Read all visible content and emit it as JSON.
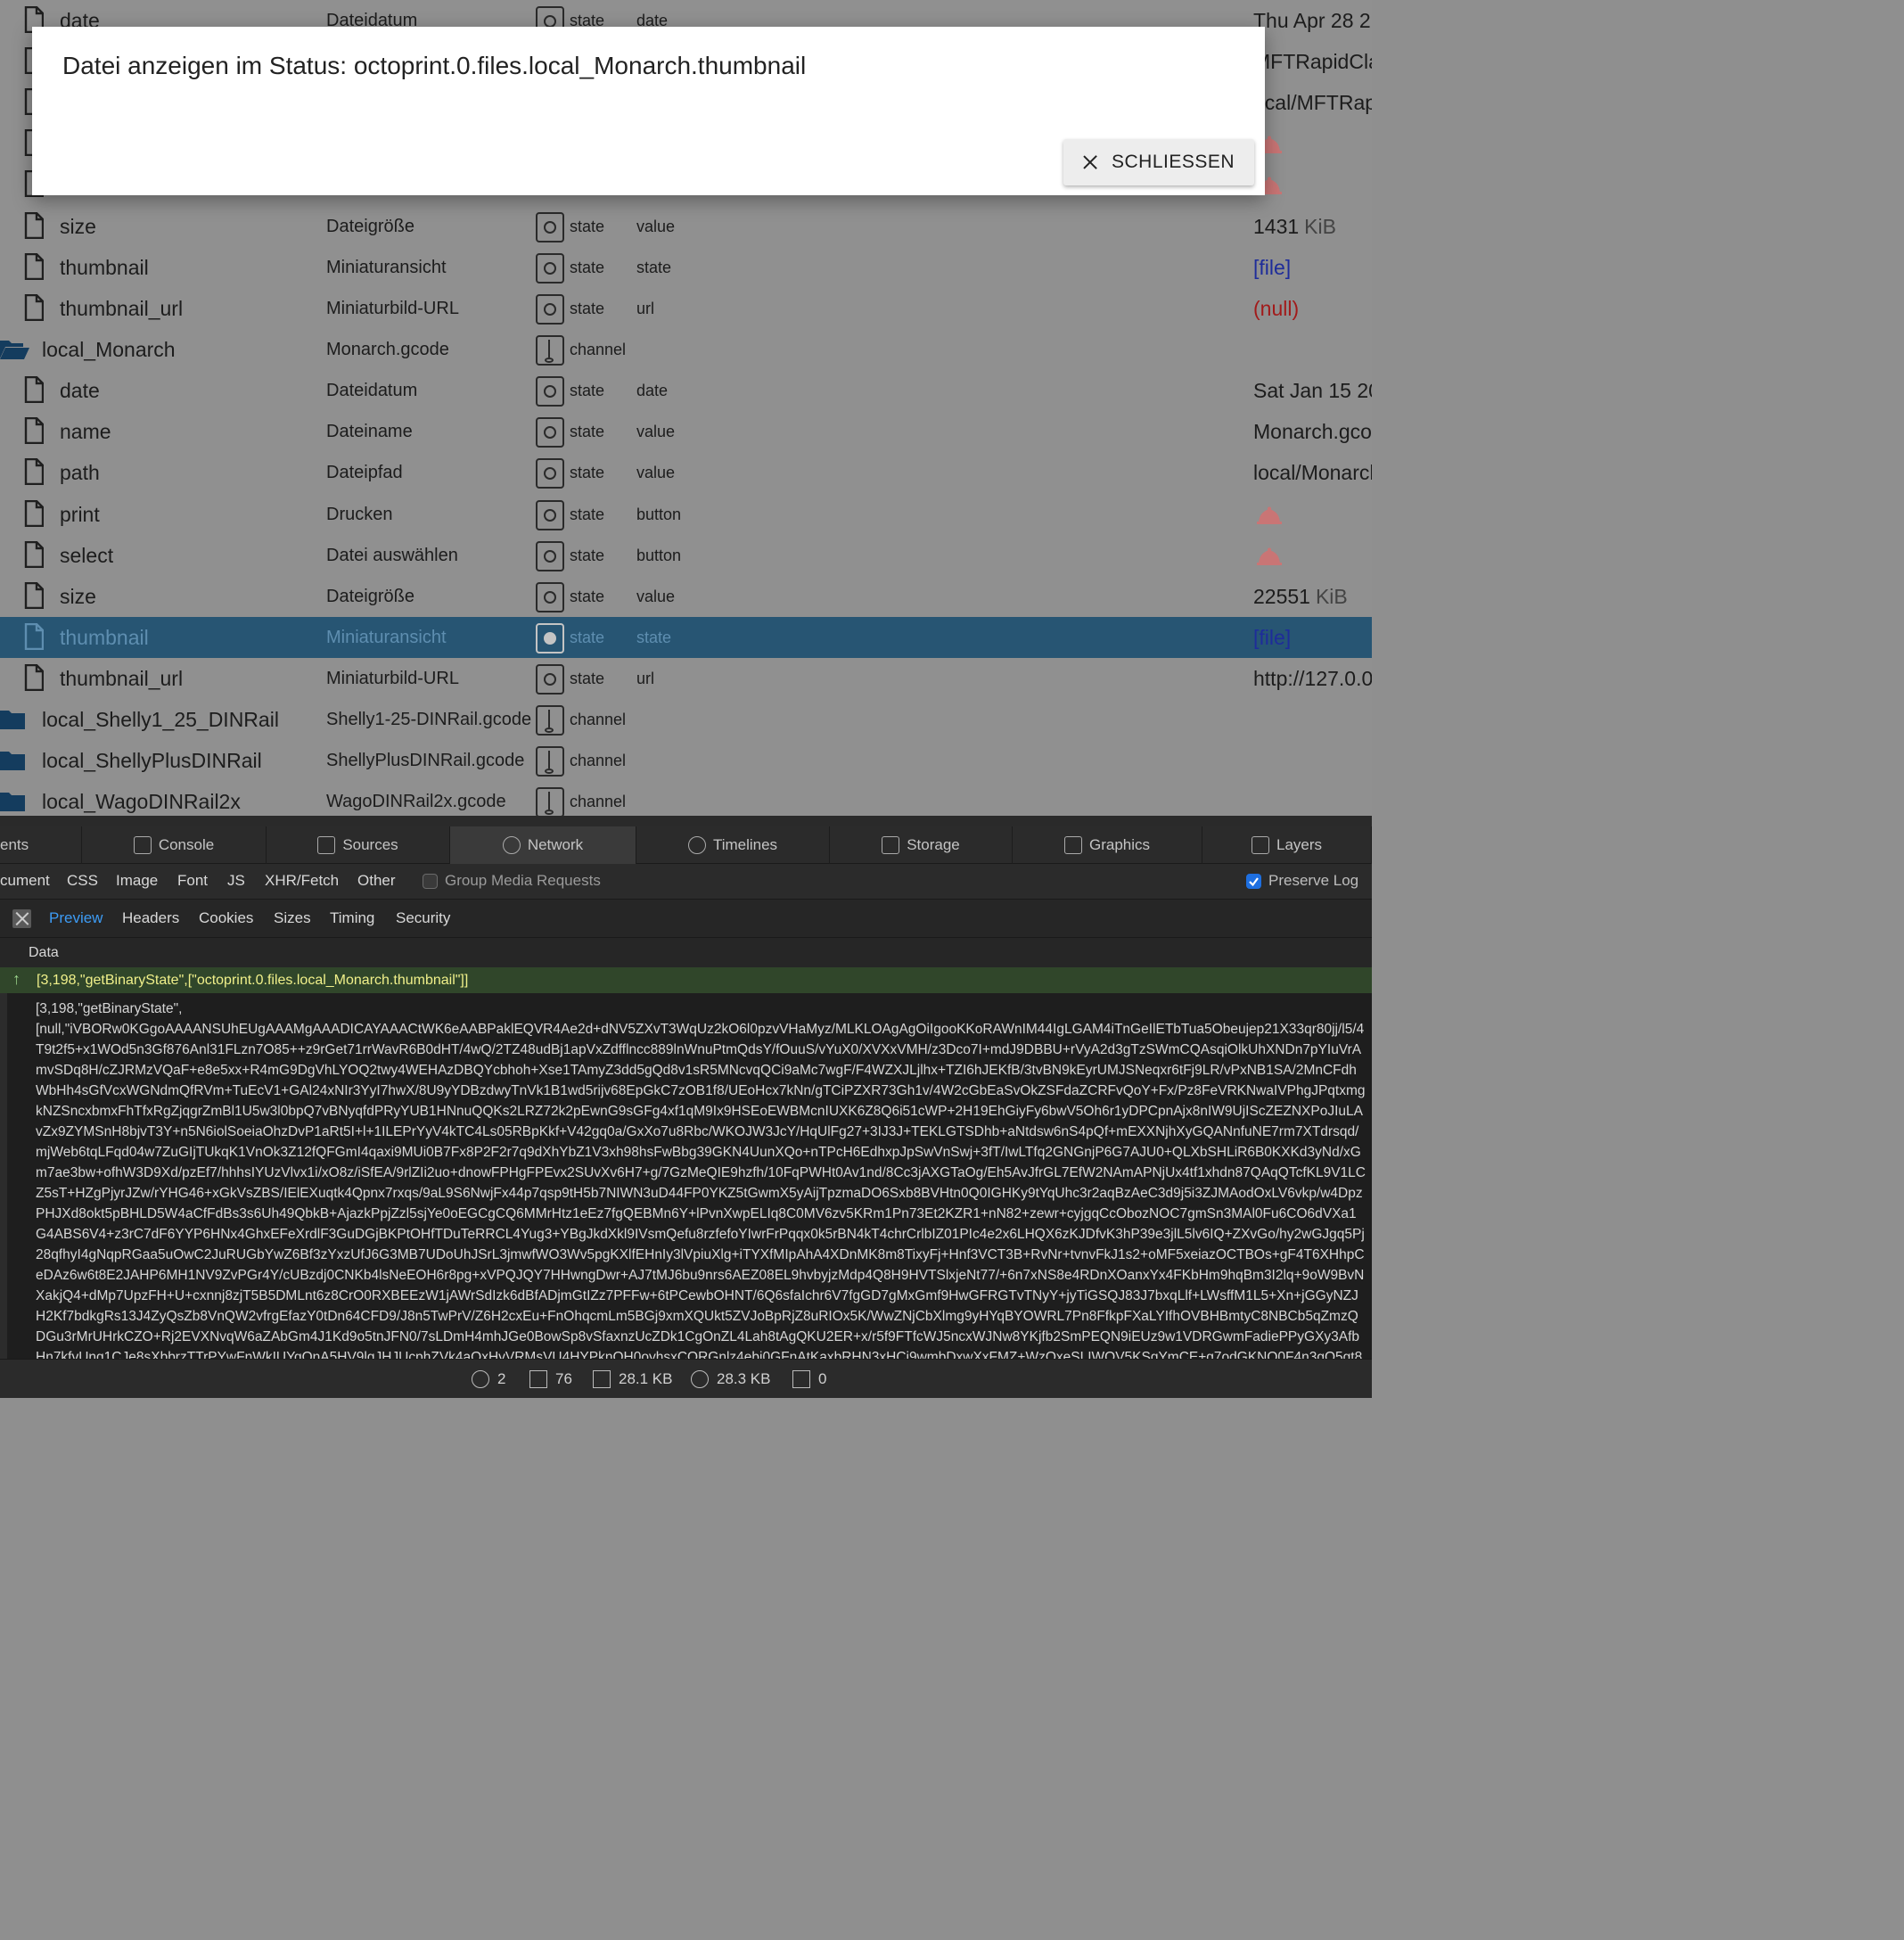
{
  "tree_rows": [
    {
      "kind": "file",
      "indent": 1,
      "name": "date",
      "desc": "Dateidatum",
      "type": "state",
      "role": "date",
      "value": "Thu Apr 28 2",
      "value_kind": "text"
    },
    {
      "kind": "file",
      "indent": 1,
      "name": "",
      "desc": "",
      "type": "",
      "role": "",
      "value": "MFTRapidCla",
      "value_kind": "text"
    },
    {
      "kind": "file",
      "indent": 1,
      "name": "",
      "desc": "",
      "type": "",
      "role": "",
      "value": "ocal/MFTRap",
      "value_kind": "text"
    },
    {
      "kind": "file",
      "indent": 1,
      "name": "",
      "desc": "",
      "type": "",
      "role": "",
      "value": "",
      "value_kind": "bell"
    },
    {
      "kind": "file",
      "indent": 1,
      "name": "",
      "desc": "",
      "type": "",
      "role": "",
      "value": "",
      "value_kind": "bell"
    },
    {
      "kind": "file",
      "indent": 1,
      "name": "size",
      "desc": "Dateigröße",
      "type": "state",
      "role": "value",
      "value": "1431",
      "unit": "KiB",
      "value_kind": "size"
    },
    {
      "kind": "file",
      "indent": 1,
      "name": "thumbnail",
      "desc": "Miniaturansicht",
      "type": "state",
      "role": "state",
      "value": "[file]",
      "value_kind": "file"
    },
    {
      "kind": "file",
      "indent": 1,
      "name": "thumbnail_url",
      "desc": "Miniaturbild-URL",
      "type": "state",
      "role": "url",
      "value": "(null)",
      "value_kind": "null"
    },
    {
      "kind": "folder-open",
      "indent": 0,
      "name": "local_Monarch",
      "desc": "Monarch.gcode",
      "type": "channel",
      "role": "",
      "value": "",
      "value_kind": "none"
    },
    {
      "kind": "file",
      "indent": 1,
      "name": "date",
      "desc": "Dateidatum",
      "type": "state",
      "role": "date",
      "value": "Sat Jan 15 20",
      "value_kind": "text"
    },
    {
      "kind": "file",
      "indent": 1,
      "name": "name",
      "desc": "Dateiname",
      "type": "state",
      "role": "value",
      "value": "Monarch.gcod",
      "value_kind": "text"
    },
    {
      "kind": "file",
      "indent": 1,
      "name": "path",
      "desc": "Dateipfad",
      "type": "state",
      "role": "value",
      "value": "local/Monarch",
      "value_kind": "text"
    },
    {
      "kind": "file",
      "indent": 1,
      "name": "print",
      "desc": "Drucken",
      "type": "state",
      "role": "button",
      "value": "",
      "value_kind": "bell"
    },
    {
      "kind": "file",
      "indent": 1,
      "name": "select",
      "desc": "Datei auswählen",
      "type": "state",
      "role": "button",
      "value": "",
      "value_kind": "bell"
    },
    {
      "kind": "file",
      "indent": 1,
      "name": "size",
      "desc": "Dateigröße",
      "type": "state",
      "role": "value",
      "value": "22551",
      "unit": "KiB",
      "value_kind": "size"
    },
    {
      "kind": "file",
      "indent": 1,
      "name": "thumbnail",
      "desc": "Miniaturansicht",
      "type": "state",
      "role": "state",
      "value": "[file]",
      "value_kind": "file",
      "selected": true
    },
    {
      "kind": "file",
      "indent": 1,
      "name": "thumbnail_url",
      "desc": "Miniaturbild-URL",
      "type": "state",
      "role": "url",
      "value": "http://127.0.0",
      "value_kind": "text"
    },
    {
      "kind": "folder",
      "indent": 0,
      "name": "local_Shelly1_25_DINRail",
      "desc": "Shelly1-25-DINRail.gcode",
      "type": "channel",
      "role": "",
      "value": "",
      "value_kind": "none"
    },
    {
      "kind": "folder",
      "indent": 0,
      "name": "local_ShellyPlusDINRail",
      "desc": "ShellyPlusDINRail.gcode",
      "type": "channel",
      "role": "",
      "value": "",
      "value_kind": "none"
    },
    {
      "kind": "folder",
      "indent": 0,
      "name": "local_WagoDINRail2x",
      "desc": "WagoDINRail2x.gcode",
      "type": "channel",
      "role": "",
      "value": "",
      "value_kind": "none"
    }
  ],
  "dialog": {
    "title": "Datei anzeigen im Status: octoprint.0.files.local_Monarch.thumbnail",
    "close_label": "SCHLIESSEN"
  },
  "devtools": {
    "tabs": [
      {
        "label": "ents",
        "icon": "elements-icon"
      },
      {
        "label": "Console",
        "icon": "console-icon"
      },
      {
        "label": "Sources",
        "icon": "sources-icon"
      },
      {
        "label": "Network",
        "icon": "network-icon",
        "active": true
      },
      {
        "label": "Timelines",
        "icon": "timelines-icon"
      },
      {
        "label": "Storage",
        "icon": "storage-icon"
      },
      {
        "label": "Graphics",
        "icon": "graphics-icon"
      },
      {
        "label": "Layers",
        "icon": "layers-icon"
      }
    ],
    "filters": [
      "cument",
      "CSS",
      "Image",
      "Font",
      "JS",
      "XHR/Fetch",
      "Other"
    ],
    "group_media_label": "Group Media Requests",
    "group_media_checked": false,
    "preserve_log_label": "Preserve Log",
    "preserve_log_checked": true,
    "subtabs": [
      "Preview",
      "Headers",
      "Cookies",
      "Sizes",
      "Timing",
      "Security"
    ],
    "active_subtab": "Preview",
    "data_header": "Data",
    "sent_message": "[3,198,\"getBinaryState\",[\"octoprint.0.files.local_Monarch.thumbnail\"]]",
    "received_message": "[3,198,\"getBinaryState\",\n[null,\"iVBORw0KGgoAAAANSUhEUgAAAMgAAADICAYAAACtWK6eAABPaklEQVR4Ae2d+dNV5ZXvT3WqUz2kO6l0pzvVHaMyz/MLKLOAgAgOiIgooKKoRAWnIM44IgLGAM4iTnGeIlETbTua5Obeujep21X33qr80jj/l5/4T9t2f5+x1WOd5n3Gf876Anl31FLzn7O85++z9rGet71rrWavR6B0dHT/4wQ/2TZ48udBj1apVxZdfflncc889lnWnuPtmQdsY/fOuuS/vYuX0/XVXxVMH/z3Dco7I+mdJ9DBBU+rVyA2d3gTzSWmCQAsqiOlkUhXNDn7pYIuVrAmvSDq8H/cZJRMzVQaF+e8e5xx+R4mG9DgVhLYOQ2twy4WEHAzDBQYcbhoh+Xse1TAmyZ3dd5gQd8v1sR5MNcvqQCi9aMc7wgF/F4WZXJLjlhx+TZI6hJEKfB/3tvBN9kEyrUMJSNeqxr6tFj9LR/vPxNB1SA/2MnCFdhWbHh4sGfVcxWGNdmQfRVm+TuEcV1+GAl24xNIr3YyI7hwX/8U9yYDBzdwyTnVk1B1wd5rijv68EpGkC7zOB1f8/UEoHcx7kNn/gTCiPZXR73Gh1v/4W2cGbEaSvOkZSFdaZCRFvQoY+Fx/Pz8FeVRKNwaIVPhgJPqtxmgkNZSncxbmxFhTfxRgZjqgrZmBl1U5w3l0bpQ7vBNyqfdPRyYUB1HNnuQQKs2LRZ72k2pEwnG9sGFg4xf1qM9Ix9HSEoEWBMcnIUXK6Z8Q6i51cWP+2H19EhGiyFy6bwV5Oh6r1yDPCpnAjx8nIW9UjIScZEZNXPoJIuLAvZx9ZYMSnH8bjvT3Y+n5N6iolSoeiaOhzDvP1aRt5I+l+1ILEPrYyV4kTC4Ls05RBpKkf+V42gq0a/GxXo7u8Rbc/WKOJW3JcY/HqUlFg27+3IJ3J+TEKLGTSDhb+aNtdsw6nS4pQf+mEXXNjhXyGQANnfuNE7rm7XTdrsqd/mjWeb6tqLFqd04w7ZuGIjTUkqK1VnOk3Z12fQFGmI4qaxi9MUi0B7Fx8P2F2r7q9dXhYbZ1V3xh98hsFwBbg39GKN4UunXQo+nTPcH6EdhxpJpSwVnSwj+3fT/IwLTfq2GNGnjP6G7AJU0+QLXbSHLiR6B0KXKd3yNd/xGm7ae3bw+ofhW3D9Xd/pzEf7/hhhsIYUzVlvx1i/xO8z/iSfEA/9rlZIi2uo+dnowFPHgFPEvx2SUvXv6H7+g/7GzMeQIE9hzfh/10FqPWHt0Av1nd/8Cc3jAXGTaOg/Eh5AvJfrGL7EfW2NAmAPNjUx4tf1xhdn87QAqQTcfKL9V1LCZ5sT+HZgPjyrJZw/rYHG46+xGkVsZBS/IElEXuqtk4Qpnx7rxqs/9aL9S6NwjFx44p7qsp9tH5b7NIWN3uD44FP0YKZ5tGwmX5yAijTpzmaDO6Sxb8BVHtn0Q0IGHKy9tYqUhc3r2aqBzAeC3d9j5i3ZJMAodOxLV6vkp/w4DpzPHJXd8okt5pBHLD5W4aCfFdBs3s6Uh49QbkB+AjazkPpjZzl5sjYe0oEGCgCQ6MMrHtz1eEz7fgQEBMn6Y+lPvnXwpELIq8C0MV6zv5KRm1Pn73Et2KZR1+nN82+zewr+cyjgqCcObozNOC7gmSn3MAl0Fu6CO6dVXa1G4ABS6V4+z3rC7dF6YYP6HNx4GhxEFeXrdlF3GuDGjBKPtOHfTDuTeRRCL4Yug3+YBgJkdXkl9IVsmQefu8rzfefoYIwrFrPqqx0k5rBN4kT4chrCrlbIZ01PIc4e2x6LHQX6zKJDfvK3hP39e3jlL5lv6IQ+ZXvGo/hy2wGJgq5Pj28qfhyI4gNqpRGaa5uOwC2JuRUGbYwZ6Bf3zYxzUfJ6G3MB7UDoUhJSrL3jmwfWO3Wv5pgKXlfEHnIy3lVpiuXlg+iTYXfMIpAhA4XDnMK8m8TixyFj+Hnf3VCT3B+RvNr+tvnvFkJ1s2+oMF5xeiazOCTBOs+gF4T6XHhpCeDAz6w6t8E2JAHP6MH1NV9ZvPGr4Y/cUBzdj0CNKb4lsNeEOH6r8pg+xVPQJQY7HHwngDwr+AJ7tMJ6bu9nrs6AEZ08EL9hvbyjzMdp4Q8H9HVTSlxjeNt77/+6n7xNS8e4RDnXOanxYx4FKbHm9hqBm3I2lq+9oW9BvNXakjQ4+dMp7UpzFH+U+cxnnj8zjT5B5DMLnt6z8CrO0RXBEEzW1jAWrSdIzk6dBfADjmGtIZz7PFFw+6tPCewbOHNT/6Q6sfaIchr6V7fgGD7gMxGmf9HwGFRGTvTNyY+jyTiGSQJ83J7bxqLlf+LWsffM1L5+Xn+jGGyNZJH2Kf7bdkgRs13J4ZyQsZb8VnQW2vfrgEfazY0tDn64CFD9/J8n5TwPrV/Z6H2cxEu+FnOhqcmLm5BGj9xmXQUkt5ZVJoBpRjZ8uRIOx5K/WwZNjCbXlmg9yHYqBYOWRL7Pn8FfkpFXaLYIfhOVBHBmtyC8NBCb5qZmzQDGu3rMrUHrkCZO+Rj2EVXNvqW6aZAbGm4J1Kd9o5tnJFN0/7sLDmH4mhJGe0BowSp8vSfaxnzUcZDk1CgOnZL4Lah8tAgQKU2ER+x/r5f9FTfcWJ5ncxWJNw8YKjfb2SmPEQN9iEUz9w1VDRGwmFadiePPyGXy3AfbHn7kfvUnq1CJe8sXbbrzTTrPYwFnWkIUYqQnA5HV9lgJHJUcphZVk4aOxHyVRMsVU4HYPknQH0oyhsxCORGnlz4ebi0GFnAtKaxbRHN3xHCj9wmbDxwXxFMZ+WzQxeSLIWQV5KSgYmCE+g7odGKNQ0F4n3gQ5gt8c7ohqyCp6LlL5l75x4yK8DaIVlfhQVVSzz2ktaWU82Vm2nw87BuxeoDKYB+7I8Y1sTyMb/L+SpX48YNLyI5oLOHsnNdvz40XZRFEdfOMRgHIFqRlVnzi7kLzFgF9jVH2Qom8aQHPoAmoNCAjSdsIFsHFg4PCy/bYDj1+ilN5hdIC+BcrfxsuKTxLDFDkSKxrzgBYbPNWcELNx/JPtRs+Ar4aiCNpyuYHh3T06QmzPb4YjnK2IAa2nwwN3Ifn3EAiDn7jzhMozcOpV/X2HGVQ+LdoJjqm+eaY/BUUlwn/UMzIqdgmCFRVYpgeP8ZQLIOKlMDLmhTdGQLyL2rWx6k3qEdS8Mt9J8Pkr1/i+MTXRizcG/4F1WfvGp9kcXk8MKZRhCUWSOjswSrkp0UWfr3PHqdJjfQ81s2Hfp3lZo5Cwcd6Xs/3eSSGGyrkkV4pjZmAbFddMp0C7x/DVXNuCaHhtUtl4A"
  },
  "status_bar": {
    "domains": "2",
    "resources": "76",
    "transferred": "28.1 KB",
    "size": "28.3 KB",
    "errors": "0"
  },
  "colors": {
    "selected_row": "#275573",
    "link_file": "#1e2c9a",
    "null_value": "#a21a1a",
    "accent_blue": "#3d9cf5",
    "sent_row_bg": "#30462a"
  }
}
